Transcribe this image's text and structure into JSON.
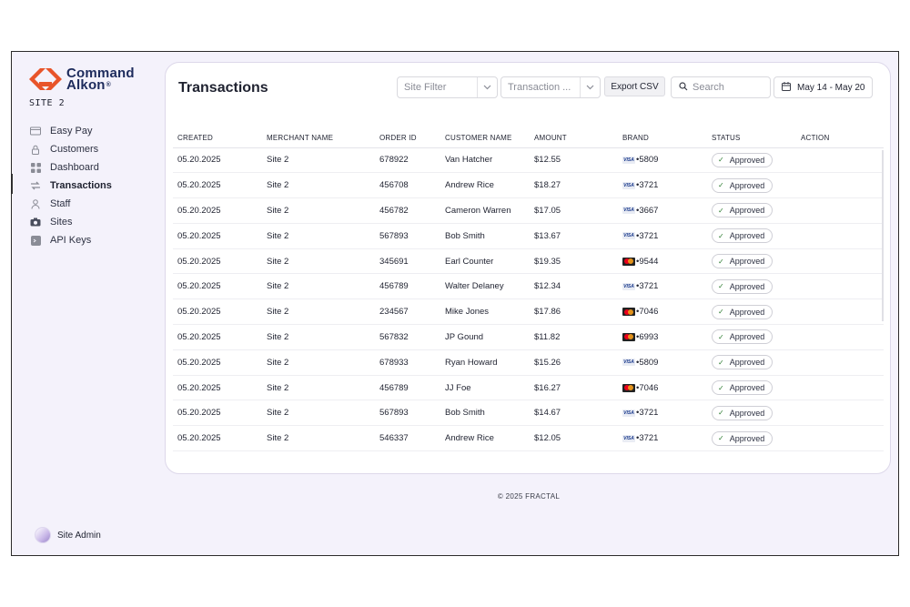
{
  "sidebar": {
    "logo": {
      "line1": "Command",
      "line2": "Alkon",
      "reg": "®"
    },
    "site_label": "SITE 2",
    "items": [
      {
        "label": "Easy Pay",
        "icon": "card-icon"
      },
      {
        "label": "Customers",
        "icon": "lock-icon"
      },
      {
        "label": "Dashboard",
        "icon": "grid-icon"
      },
      {
        "label": "Transactions",
        "icon": "transfer-icon",
        "active": true
      },
      {
        "label": "Staff",
        "icon": "user-icon"
      },
      {
        "label": "Sites",
        "icon": "camera-icon"
      },
      {
        "label": "API Keys",
        "icon": "terminal-icon"
      }
    ],
    "user": {
      "name": "Site Admin"
    }
  },
  "main": {
    "title": "Transactions",
    "site_filter_placeholder": "Site Filter",
    "transaction_filter_placeholder": "Transaction ...",
    "export_label": "Export CSV",
    "search_placeholder": "Search",
    "date_range": "May 14 - May 20",
    "columns": [
      "CREATED",
      "MERCHANT NAME",
      "ORDER ID",
      "CUSTOMER NAME",
      "AMOUNT",
      "BRAND",
      "STATUS",
      "ACTION"
    ],
    "rows": [
      {
        "created": "05.20.2025",
        "merchant": "Site 2",
        "order_id": "678922",
        "customer": "Van Hatcher",
        "amount": "$12.55",
        "brand": "visa",
        "last4": "•5809",
        "status": "Approved"
      },
      {
        "created": "05.20.2025",
        "merchant": "Site 2",
        "order_id": "456708",
        "customer": "Andrew Rice",
        "amount": "$18.27",
        "brand": "visa",
        "last4": "•3721",
        "status": "Approved"
      },
      {
        "created": "05.20.2025",
        "merchant": "Site 2",
        "order_id": "456782",
        "customer": "Cameron Warren",
        "amount": "$17.05",
        "brand": "visa",
        "last4": "•3667",
        "status": "Approved"
      },
      {
        "created": "05.20.2025",
        "merchant": "Site 2",
        "order_id": "567893",
        "customer": "Bob Smith",
        "amount": "$13.67",
        "brand": "visa",
        "last4": "•3721",
        "status": "Approved"
      },
      {
        "created": "05.20.2025",
        "merchant": "Site 2",
        "order_id": "345691",
        "customer": "Earl Counter",
        "amount": "$19.35",
        "brand": "mastercard",
        "last4": "•9544",
        "status": "Approved"
      },
      {
        "created": "05.20.2025",
        "merchant": "Site 2",
        "order_id": "456789",
        "customer": "Walter Delaney",
        "amount": "$12.34",
        "brand": "visa",
        "last4": "•3721",
        "status": "Approved"
      },
      {
        "created": "05.20.2025",
        "merchant": "Site 2",
        "order_id": "234567",
        "customer": "Mike Jones",
        "amount": "$17.86",
        "brand": "mastercard",
        "last4": "•7046",
        "status": "Approved"
      },
      {
        "created": "05.20.2025",
        "merchant": "Site 2",
        "order_id": "567832",
        "customer": "JP Gound",
        "amount": "$11.82",
        "brand": "mastercard",
        "last4": "•6993",
        "status": "Approved"
      },
      {
        "created": "05.20.2025",
        "merchant": "Site 2",
        "order_id": "678933",
        "customer": "Ryan Howard",
        "amount": "$15.26",
        "brand": "visa",
        "last4": "•5809",
        "status": "Approved"
      },
      {
        "created": "05.20.2025",
        "merchant": "Site 2",
        "order_id": "456789",
        "customer": "JJ Foe",
        "amount": "$16.27",
        "brand": "mastercard",
        "last4": "•7046",
        "status": "Approved"
      },
      {
        "created": "05.20.2025",
        "merchant": "Site 2",
        "order_id": "567893",
        "customer": "Bob Smith",
        "amount": "$14.67",
        "brand": "visa",
        "last4": "•3721",
        "status": "Approved"
      },
      {
        "created": "05.20.2025",
        "merchant": "Site 2",
        "order_id": "546337",
        "customer": "Andrew Rice",
        "amount": "$12.05",
        "brand": "visa",
        "last4": "•3721",
        "status": "Approved"
      }
    ]
  },
  "footer": {
    "text": "© 2025 FRACTAL"
  },
  "colors": {
    "brand_orange": "#e8542a",
    "brand_navy": "#1d2b5c",
    "page_bg": "#f4f2fb",
    "approved_check": "#2e7d32"
  }
}
